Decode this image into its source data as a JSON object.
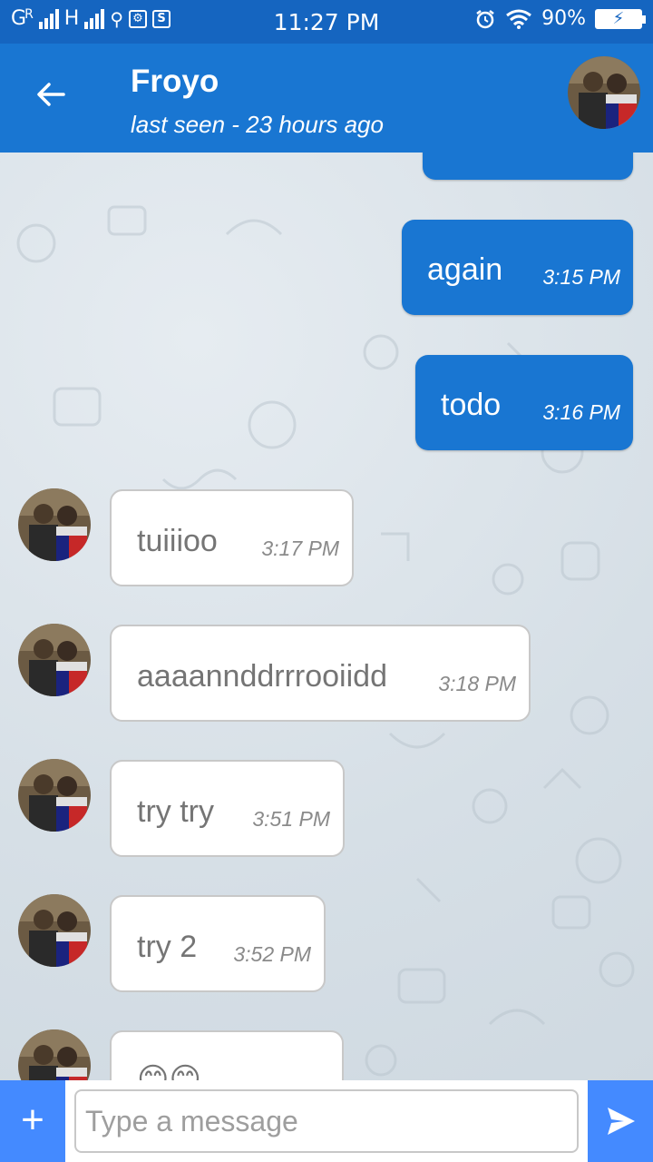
{
  "status_bar": {
    "carrier1": "G",
    "roaming": "R",
    "carrier2": "H",
    "time": "11:27 PM",
    "battery_percent": "90%"
  },
  "header": {
    "title": "Froyo",
    "subtitle": "last seen - 23 hours ago"
  },
  "messages": [
    {
      "direction": "outgoing",
      "text": "again",
      "time": "3:15 PM"
    },
    {
      "direction": "outgoing",
      "text": "todo",
      "time": "3:16 PM"
    },
    {
      "direction": "incoming",
      "text": "tuiiioo",
      "time": "3:17 PM"
    },
    {
      "direction": "incoming",
      "text": "aaaannddrrrooiidd",
      "time": "3:18 PM"
    },
    {
      "direction": "incoming",
      "text": "try try",
      "time": "3:51 PM"
    },
    {
      "direction": "incoming",
      "text": "try 2",
      "time": "3:52 PM"
    },
    {
      "direction": "incoming",
      "text": "😊😊",
      "time": ""
    }
  ],
  "composer": {
    "placeholder": "Type a message",
    "plus_label": "+"
  },
  "colors": {
    "status_bar": "#1565c0",
    "app_bar": "#1976d2",
    "outgoing_bubble": "#1976d2",
    "action_button": "#448aff"
  }
}
